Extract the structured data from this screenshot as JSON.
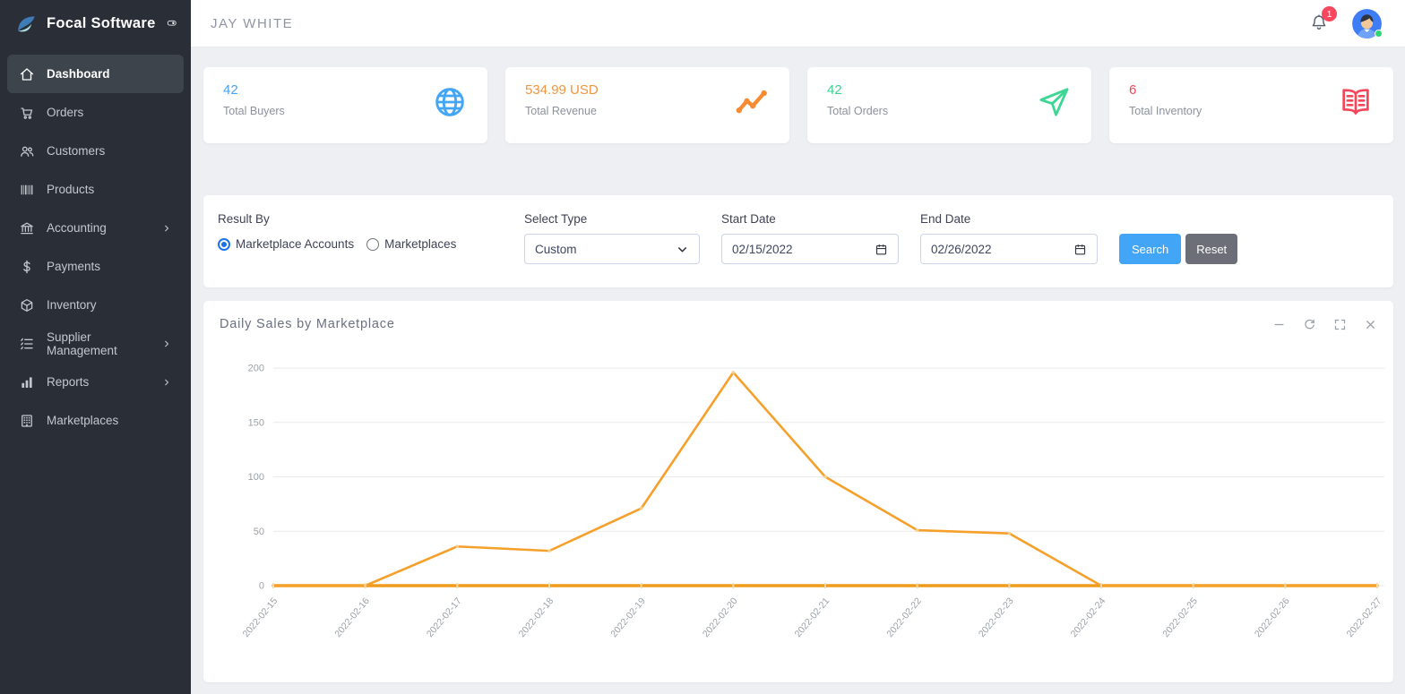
{
  "sidebar": {
    "brand": "Focal Software",
    "items": [
      {
        "label": "Dashboard",
        "icon": "home-icon",
        "active": true,
        "expandable": false
      },
      {
        "label": "Orders",
        "icon": "cart-icon",
        "active": false,
        "expandable": false
      },
      {
        "label": "Customers",
        "icon": "users-icon",
        "active": false,
        "expandable": false
      },
      {
        "label": "Products",
        "icon": "barcode-icon",
        "active": false,
        "expandable": false
      },
      {
        "label": "Accounting",
        "icon": "bank-icon",
        "active": false,
        "expandable": true
      },
      {
        "label": "Payments",
        "icon": "dollar-icon",
        "active": false,
        "expandable": false
      },
      {
        "label": "Inventory",
        "icon": "cube-icon",
        "active": false,
        "expandable": false
      },
      {
        "label": "Supplier Management",
        "icon": "list-icon",
        "active": false,
        "expandable": true
      },
      {
        "label": "Reports",
        "icon": "bar-chart-icon",
        "active": false,
        "expandable": true
      },
      {
        "label": "Marketplaces",
        "icon": "building-icon",
        "active": false,
        "expandable": false
      }
    ]
  },
  "header": {
    "title": "JAY WHITE",
    "notification_count": "1"
  },
  "stats_cards": [
    {
      "value": "42",
      "label": "Total Buyers",
      "icon": "globe-icon",
      "color": "#4aa3f2"
    },
    {
      "value": "534.99 USD",
      "label": "Total Revenue",
      "icon": "trend-icon",
      "color": "#f0953f"
    },
    {
      "value": "42",
      "label": "Total Orders",
      "icon": "send-icon",
      "color": "#3fd092"
    },
    {
      "value": "6",
      "label": "Total Inventory",
      "icon": "book-icon",
      "color": "#f4455a"
    }
  ],
  "filters": {
    "result_by_label": "Result By",
    "radios": [
      {
        "label": "Marketplace Accounts",
        "selected": true
      },
      {
        "label": "Marketplaces",
        "selected": false
      }
    ],
    "select_type_label": "Select Type",
    "select_value": "Custom",
    "start_date_label": "Start Date",
    "start_date_value": "02/15/2022",
    "end_date_label": "End Date",
    "end_date_value": "02/26/2022",
    "search_label": "Search",
    "reset_label": "Reset"
  },
  "chart_panel": {
    "title": "Daily Sales by Marketplace"
  },
  "chart_data": {
    "type": "line",
    "title": "Daily Sales by Marketplace",
    "x": [
      "2022-02-15",
      "2022-02-16",
      "2022-02-17",
      "2022-02-18",
      "2022-02-19",
      "2022-02-20",
      "2022-02-21",
      "2022-02-22",
      "2022-02-23",
      "2022-02-24",
      "2022-02-25",
      "2022-02-26",
      "2022-02-27"
    ],
    "series": [
      {
        "name": "series_1",
        "color": "#f5a02b",
        "values": [
          0,
          0,
          36,
          32,
          71,
          196,
          100,
          51,
          48,
          0,
          0,
          0,
          0
        ]
      },
      {
        "name": "series_2",
        "color": "#ef9c1d",
        "values": [
          0,
          0,
          0,
          0,
          0,
          0,
          0,
          0,
          0,
          0,
          0,
          0,
          0
        ]
      }
    ],
    "xlabel": "",
    "ylabel": "",
    "ylim": [
      0,
      200
    ],
    "yticks": [
      0,
      50,
      100,
      150,
      200
    ],
    "grid": true,
    "legend": "none"
  }
}
